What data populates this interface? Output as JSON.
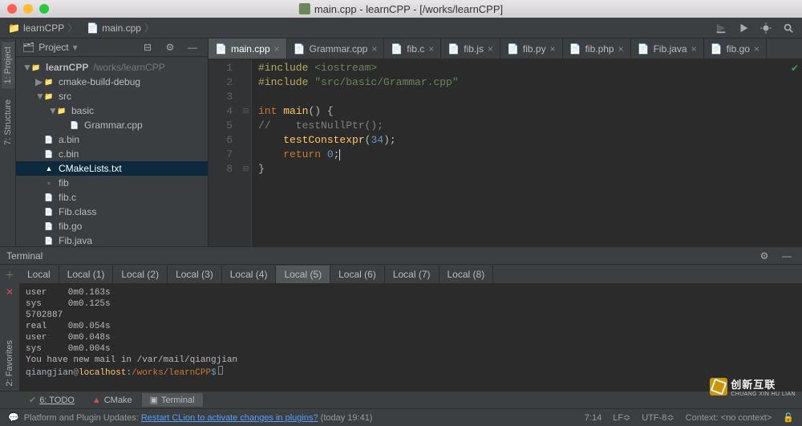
{
  "window_title": "main.cpp - learnCPP - [/works/learnCPP]",
  "breadcrumb": {
    "root": "learnCPP",
    "file": "main.cpp"
  },
  "sidebar": {
    "title": "Project",
    "root": {
      "name": "learnCPP",
      "path": "/works/learnCPP"
    },
    "items": [
      {
        "name": "cmake-build-debug",
        "type": "folder",
        "indent": 1,
        "expanded": false
      },
      {
        "name": "src",
        "type": "folder",
        "indent": 1,
        "expanded": true
      },
      {
        "name": "basic",
        "type": "folder",
        "indent": 2,
        "expanded": true
      },
      {
        "name": "Grammar.cpp",
        "type": "cpp",
        "indent": 3
      },
      {
        "name": "a.bin",
        "type": "bin",
        "indent": 1
      },
      {
        "name": "c.bin",
        "type": "bin",
        "indent": 1
      },
      {
        "name": "CMakeLists.txt",
        "type": "cmake",
        "indent": 1,
        "selected": true
      },
      {
        "name": "fib",
        "type": "file",
        "indent": 1
      },
      {
        "name": "fib.c",
        "type": "c",
        "indent": 1
      },
      {
        "name": "Fib.class",
        "type": "class",
        "indent": 1
      },
      {
        "name": "fib.go",
        "type": "go",
        "indent": 1
      },
      {
        "name": "Fib.java",
        "type": "java",
        "indent": 1
      }
    ]
  },
  "left_gutter_tabs": [
    {
      "label": "1: Project",
      "active": true
    },
    {
      "label": "7: Structure",
      "active": false
    },
    {
      "label": "2: Favorites",
      "active": false
    }
  ],
  "editor_tabs": [
    {
      "label": "main.cpp",
      "type": "cpp",
      "active": true
    },
    {
      "label": "Grammar.cpp",
      "type": "cpp"
    },
    {
      "label": "fib.c",
      "type": "c"
    },
    {
      "label": "fib.js",
      "type": "js"
    },
    {
      "label": "fib.py",
      "type": "py"
    },
    {
      "label": "fib.php",
      "type": "php"
    },
    {
      "label": "Fib.java",
      "type": "java"
    },
    {
      "label": "fib.go",
      "type": "go"
    }
  ],
  "code": {
    "lines": [
      1,
      2,
      3,
      4,
      5,
      6,
      7,
      8
    ],
    "l1_a": "#include",
    "l1_b": " <iostream>",
    "l2_a": "#include",
    "l2_b": " \"src/basic/Grammar.cpp\"",
    "l4_a": "int",
    "l4_b": " ",
    "l4_c": "main",
    "l4_d": "() {",
    "l5_a": "//    testNullPtr();",
    "l6_a": "    ",
    "l6_b": "testConstexpr",
    "l6_c": "(",
    "l6_num": "34",
    "l6_d": ");",
    "l7_a": "    ",
    "l7_b": "return",
    "l7_c": " ",
    "l7_num": "0",
    "l7_d": ";",
    "l8": "}"
  },
  "terminal": {
    "header": "Terminal",
    "tabs": [
      "Local",
      "Local (1)",
      "Local (2)",
      "Local (3)",
      "Local (4)",
      "Local (5)",
      "Local (6)",
      "Local (7)",
      "Local (8)"
    ],
    "active_tab": 5,
    "lines": [
      "user    0m0.163s",
      "sys     0m0.125s",
      "5702887",
      "",
      "real    0m0.054s",
      "user    0m0.048s",
      "sys     0m0.004s",
      "You have new mail in /var/mail/qiangjian"
    ],
    "prompt": {
      "user": "qiangjian",
      "at": "@",
      "host": "localhost",
      "colon": ":",
      "path": "/works/learnCPP",
      "dollar": "$"
    }
  },
  "bottom_tabs": [
    {
      "label": "6: TODO"
    },
    {
      "label": "CMake"
    },
    {
      "label": "Terminal",
      "active": true
    }
  ],
  "status": {
    "msg_prefix": "Platform and Plugin Updates: ",
    "msg_link": "Restart CLion to activate changes in plugins?",
    "msg_suffix": " (today 19:41)",
    "pos": "7:14",
    "line_sep": "LF≎",
    "encoding": "UTF-8≎",
    "context": "Context: <no context>"
  },
  "logo": {
    "cn": "创新互联",
    "en": "CHUANG XIN HU LIAN"
  }
}
